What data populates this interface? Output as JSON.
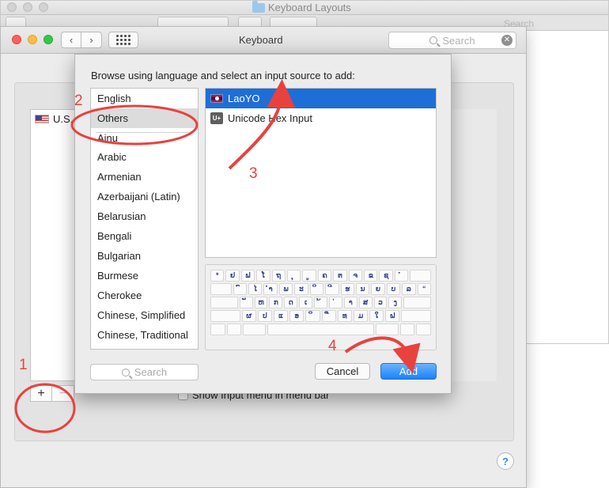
{
  "finder": {
    "title": "Keyboard Layouts",
    "search_ghost": "Search"
  },
  "window": {
    "title": "Keyboard",
    "search_placeholder": "Search"
  },
  "input_sources": {
    "items": [
      {
        "label": "U.S."
      }
    ]
  },
  "controls": {
    "add_symbol": "+",
    "remove_symbol": "−",
    "show_input_menu_label": "Show Input menu in menu bar",
    "help_symbol": "?"
  },
  "sheet": {
    "prompt": "Browse using language and select an input source to add:",
    "languages": [
      "English",
      "Others",
      "Ainu",
      "Arabic",
      "Armenian",
      "Azerbaijani (Latin)",
      "Belarusian",
      "Bengali",
      "Bulgarian",
      "Burmese",
      "Cherokee",
      "Chinese, Simplified",
      "Chinese, Traditional"
    ],
    "selected_language": "Others",
    "sources": [
      {
        "label": "LaoYO",
        "icon": "lao-flag-icon",
        "selected": true
      },
      {
        "label": "Unicode Hex Input",
        "icon": "unicode-hex-icon",
        "selected": false
      }
    ],
    "search_placeholder": "Search",
    "cancel_label": "Cancel",
    "add_label": "Add",
    "keyboard_rows": [
      [
        "*",
        "ຢ",
        "ຟ",
        "ໂ",
        "ຖ",
        "ຸ",
        "ູ",
        "ຄ",
        "ຕ",
        "ຈ",
        "ຂ",
        "ຊ",
        "ໍ",
        ""
      ],
      [
        "",
        "ົ",
        "ໄ",
        "ຳ",
        "ພ",
        "ະ",
        "ິ",
        "ີ",
        "ຮ",
        "ນ",
        "ຍ",
        "ບ",
        "ລ",
        "“"
      ],
      [
        "",
        "ັ",
        "ຫ",
        "ກ",
        "ດ",
        "ເ",
        "້",
        "່",
        "າ",
        "ສ",
        "ວ",
        "ງ",
        ""
      ],
      [
        "",
        "ຜ",
        "ປ",
        "ແ",
        "ອ",
        "ິ",
        "ື",
        "ທ",
        "ມ",
        "ໃ",
        "ຝ",
        ""
      ],
      [
        "",
        "",
        "",
        "",
        "",
        "",
        ""
      ]
    ]
  },
  "annotations": {
    "step1": "1",
    "step2": "2",
    "step3": "3",
    "step4": "4",
    "color": "#e8423e"
  }
}
